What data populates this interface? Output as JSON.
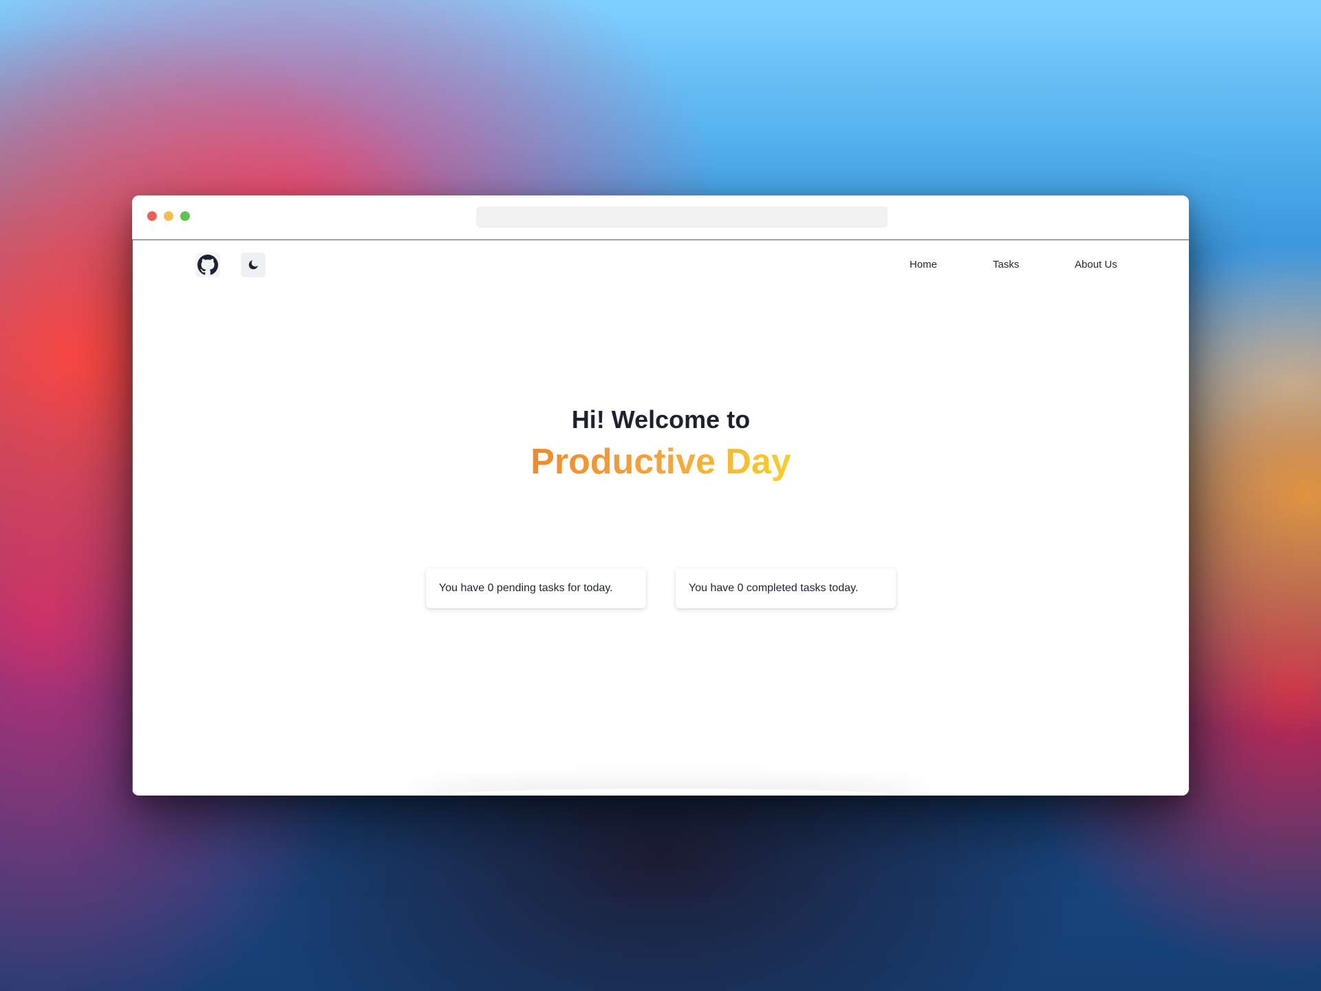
{
  "browser": {
    "window_controls": [
      "close",
      "minimize",
      "maximize"
    ],
    "address_bar": ""
  },
  "navbar": {
    "icons": [
      "github-icon",
      "moon-icon"
    ],
    "links": [
      "Home",
      "Tasks",
      "About Us"
    ]
  },
  "hero": {
    "greeting": "Hi! Welcome to",
    "app_name": "Productive Day",
    "gradient": [
      "#f08a2c",
      "#f6cf2c"
    ]
  },
  "stats": {
    "pending": "You have 0 pending tasks for today.",
    "completed": "You have 0 completed tasks today."
  },
  "colors": {
    "text": "#1c2230",
    "close": "#ec5f57",
    "minimize": "#f3bd4f",
    "maximize": "#5fc350"
  }
}
